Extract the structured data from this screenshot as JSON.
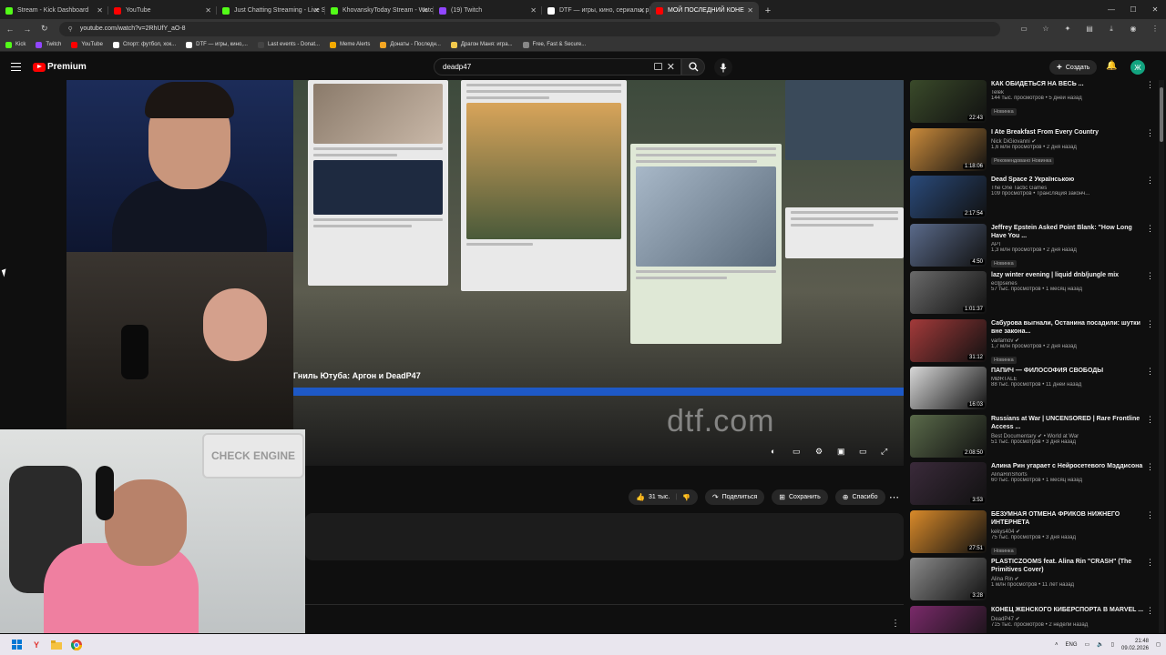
{
  "browser": {
    "tabs": [
      {
        "label": "Stream - Kick Dashboard",
        "color": "#53fc18"
      },
      {
        "label": "YouTube",
        "color": "#ff0000"
      },
      {
        "label": "Just Chatting Streaming - Live S",
        "color": "#53fc18"
      },
      {
        "label": "KhovanskyToday Stream - Watc",
        "color": "#53fc18"
      },
      {
        "label": "(19) Twitch",
        "color": "#9146ff"
      },
      {
        "label": "DTF — игры, кино, сериалы, р",
        "color": "#ffffff"
      },
      {
        "label": "МОЙ ПОСЛЕДНИЙ КОНЕ",
        "color": "#ff0000"
      }
    ],
    "new_tab": "+",
    "url": "youtube.com/watch?v=2RhUfY_aO-8",
    "bookmarks": [
      {
        "label": "Kick",
        "color": "#53fc18"
      },
      {
        "label": "Twitch",
        "color": "#9146ff"
      },
      {
        "label": "YouTube",
        "color": "#ff0000"
      },
      {
        "label": "Спорт: футбол, хок...",
        "color": "#ffffff"
      },
      {
        "label": "DTF — игры, кино,...",
        "color": "#ffffff"
      },
      {
        "label": "Last events - Donat...",
        "color": "#444444"
      },
      {
        "label": "Meme Alerts",
        "color": "#f2a900"
      },
      {
        "label": "Донаты - Последн...",
        "color": "#f5a623"
      },
      {
        "label": "Драгон Маня: игра...",
        "color": "#f2c94c"
      },
      {
        "label": "Free, Fast & Secure...",
        "color": "#888888"
      }
    ]
  },
  "youtube": {
    "logo_label": "Premium",
    "search_value": "deadp47",
    "create_label": "Создать",
    "avatar_letter": "Ж",
    "video": {
      "caption": "Гниль Ютуба: Аргон и DeadP47",
      "watermark": "dtf.com"
    },
    "actions": {
      "likes": "31 тыс.",
      "share": "Поделиться",
      "save": "Сохранить",
      "thanks": "Спасибо"
    }
  },
  "sidebar": [
    {
      "title": "КАК ОБИДЕТЬСЯ НА ВЕСЬ ...",
      "channel": "Telek",
      "stats": "144 тыс. просмотров • 5 дней назад",
      "badge": "Новинка",
      "duration": "22:43",
      "thumb": "#3a4a2a"
    },
    {
      "title": "I Ate Breakfast From Every Country",
      "channel": "Nick DiGiovanni ✔",
      "stats": "1,6 млн просмотров • 2 дня назад",
      "badge": "Рекомендовано  Новинка",
      "duration": "1:18:06",
      "thumb": "#c98a3b"
    },
    {
      "title": "Dead Space  2 Українською",
      "channel": "The One Tactic Games",
      "stats": "109 просмотров • Трансляция законч...",
      "badge": "",
      "duration": "2:17:54",
      "thumb": "#2a4a7a"
    },
    {
      "title": "Jeffrey Epstein Asked Point Blank: \"How Long Have You ...",
      "channel": "АРТ",
      "stats": "1,3 млн просмотров • 2 дня назад",
      "badge": "Новинка",
      "duration": "4:50",
      "thumb": "#5a6a8a"
    },
    {
      "title": "lazy winter evening | liquid dnb/jungle mix",
      "channel": "ecl|pseries",
      "stats": "57 тыс. просмотров • 1 месяц назад",
      "badge": "",
      "duration": "1:01:37",
      "thumb": "#6a6a6a"
    },
    {
      "title": "Сабурова выгнали, Останина посадили: шутки вне закона...",
      "channel": "varlamov ✔",
      "stats": "1,7 млн просмотров • 2 дня назад",
      "badge": "Новинка",
      "duration": "31:12",
      "thumb": "#a33a3a"
    },
    {
      "title": "ПАПИЧ — ФИЛОСОФИЯ СВОБОДЫ",
      "channel": "MØRTALE",
      "stats": "88 тыс. просмотров • 11 дней назад",
      "badge": "",
      "duration": "16:03",
      "thumb": "#d8d8d8"
    },
    {
      "title": "Russians at War | UNCENSORED | Rare Frontline Access ...",
      "channel": "Best Documentary ✔ • World at War",
      "stats": "51 тыс. просмотров • 3 дня назад",
      "badge": "",
      "duration": "2:08:50",
      "thumb": "#5a6a4a"
    },
    {
      "title": "Алина Рин угарает с Нейросетевого Мэддисона",
      "channel": "AlinaRinShorts",
      "stats": "60 тыс. просмотров • 1 месяц назад",
      "badge": "",
      "duration": "3:53",
      "thumb": "#3a2a3a"
    },
    {
      "title": "БЕЗУМНАЯ ОТМЕНА ФРИКОВ НИЖНЕГО ИНТЕРНЕТА",
      "channel": "kekys404 ✔",
      "stats": "75 тыс. просмотров • 3 дня назад",
      "badge": "Новинка",
      "duration": "27:51",
      "thumb": "#d98a2a"
    },
    {
      "title": "PLASTICZOOMS feat. Alina Rin \"CRASH\" (The Primitives Cover)",
      "channel": "Alina Rin ✔",
      "stats": "1 млн просмотров • 11 лет назад",
      "badge": "",
      "duration": "3:28",
      "thumb": "#8a8a8a"
    },
    {
      "title": "КОНЕЦ ЖЕНСКОГО КИБЕРСПОРТА В MARVEL ...",
      "channel": "DeadP47 ✔",
      "stats": "715 тыс. просмотров • 2 недели назад",
      "badge": "",
      "duration": "15:09",
      "thumb": "#7a2a6a"
    }
  ],
  "taskbar": {
    "lang": "ENG",
    "time": "21:48",
    "date": "09.02.2026"
  },
  "cam": {
    "sign": "CHECK ENGINE"
  }
}
